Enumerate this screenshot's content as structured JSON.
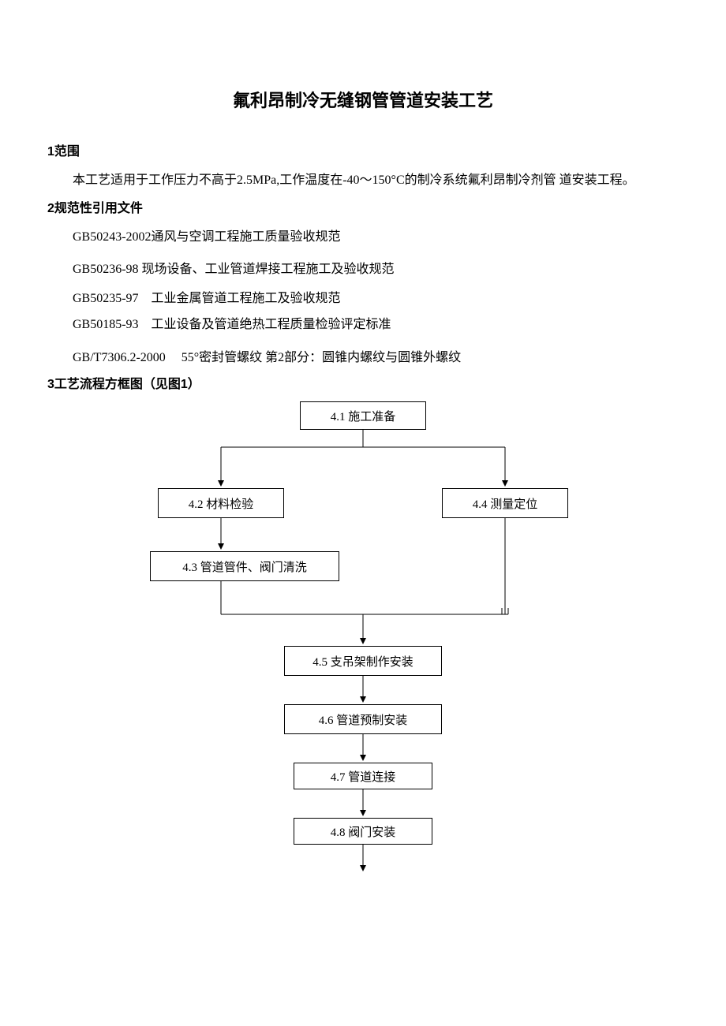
{
  "doc": {
    "title": "氟利昂制冷无缝钢管管道安装工艺",
    "sections": {
      "s1": {
        "heading": "1范围",
        "body": "本工艺适用于工作压力不高于2.5MPa,工作温度在-40〜150°C的制冷系统氟利昂制冷剂管 道安装工程。"
      },
      "s2": {
        "heading": "2规范性引用文件",
        "refs": {
          "r1": "GB50243-2002通风与空调工程施工质量验收规范",
          "r2": "GB50236-98 现场设备、工业管道焊接工程施工及验收规范",
          "r3": "GB50235-97    工业金属管道工程施工及验收规范",
          "r4": "GB50185-93    工业设备及管道绝热工程质量检验评定标准",
          "r5": "GB/T7306.2-2000     55°密封管螺纹 第2部分：圆锥内螺纹与圆锥外螺纹"
        }
      },
      "s3": {
        "heading": "3工艺流程方框图（见图1）"
      }
    },
    "flow": {
      "n41": "4.1   施工准备",
      "n42": "4.2   材料检验",
      "n44": "4.4   测量定位",
      "n43": "4.3   管道管件、阀门清洗",
      "n45": "4.5   支吊架制作安装",
      "n46": "4.6   管道预制安装",
      "n47": "4.7   管道连接",
      "n48": "4.8   阀门安装"
    }
  }
}
